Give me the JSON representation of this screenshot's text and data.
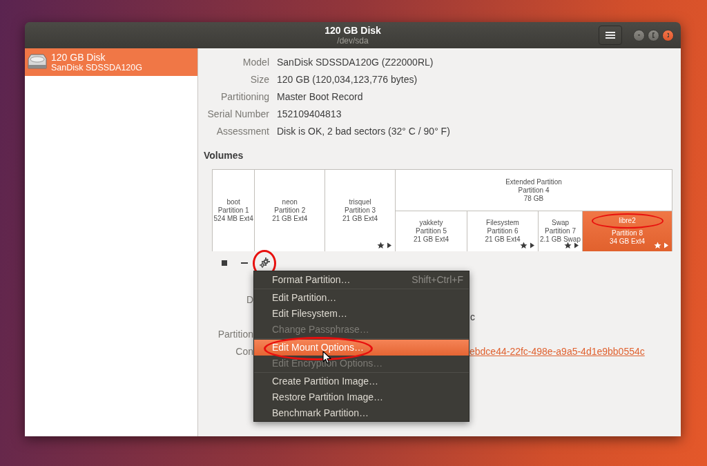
{
  "window": {
    "title": "120 GB Disk",
    "subtitle": "/dev/sda"
  },
  "sidebar": {
    "items": [
      {
        "title": "120 GB Disk",
        "subtitle": "SanDisk SDSSDA120G",
        "selected": true
      }
    ]
  },
  "drive_info": [
    {
      "label": "Model",
      "value": "SanDisk SDSSDA120G (Z22000RL)"
    },
    {
      "label": "Size",
      "value": "120 GB (120,034,123,776 bytes)"
    },
    {
      "label": "Partitioning",
      "value": "Master Boot Record"
    },
    {
      "label": "Serial Number",
      "value": "152109404813"
    },
    {
      "label": "Assessment",
      "value": "Disk is OK, 2 bad sectors (32° C / 90° F)"
    }
  ],
  "volumes": {
    "heading": "Volumes",
    "partitions": [
      {
        "name": "boot",
        "number": "Partition 1",
        "size": "524 MB Ext4",
        "selected": false,
        "show_actions": false,
        "circled": false
      },
      {
        "name": "neon",
        "number": "Partition 2",
        "size": "21 GB Ext4",
        "selected": false,
        "show_actions": false,
        "circled": false
      },
      {
        "name": "trisquel",
        "number": "Partition 3",
        "size": "21 GB Ext4",
        "selected": false,
        "show_actions": true,
        "circled": false
      },
      {
        "name": "Extended Partition",
        "number": "Partition 4",
        "size": "78 GB",
        "selected": false,
        "children": [
          {
            "name": "yakkety",
            "number": "Partition 5",
            "size": "21 GB Ext4",
            "selected": false,
            "show_actions": false,
            "circled": false
          },
          {
            "name": "Filesystem",
            "number": "Partition 6",
            "size": "21 GB Ext4",
            "selected": false,
            "show_actions": true,
            "circled": false
          },
          {
            "name": "Swap",
            "number": "Partition 7",
            "size": "2.1 GB Swap",
            "selected": false,
            "show_actions": true,
            "circled": false
          },
          {
            "name": "libre2",
            "number": "Partition 8",
            "size": "34 GB Ext4",
            "selected": true,
            "show_actions": true,
            "circled": true
          }
        ]
      }
    ],
    "toolbar": [
      {
        "kind": "stop",
        "circled": false
      },
      {
        "kind": "delete",
        "circled": false
      },
      {
        "kind": "settings",
        "circled": true
      }
    ]
  },
  "partition_details": [
    {
      "label": "D"
    },
    {
      "value": "c"
    },
    {
      "label": "Partition"
    },
    {
      "label": "Con",
      "link": "ebdce44-22fc-498e-a9a5-4d1e9bb0554c"
    }
  ],
  "context_menu": {
    "items": [
      {
        "kind": "item",
        "label": "Format Partition…",
        "shortcut": "Shift+Ctrl+F",
        "disabled": false,
        "selected": false,
        "circled": false
      },
      {
        "kind": "separator"
      },
      {
        "kind": "item",
        "label": "Edit Partition…",
        "disabled": false,
        "selected": false,
        "circled": false
      },
      {
        "kind": "item",
        "label": "Edit Filesystem…",
        "disabled": false,
        "selected": false,
        "circled": false
      },
      {
        "kind": "item",
        "label": "Change Passphrase…",
        "disabled": true,
        "selected": false,
        "circled": false
      },
      {
        "kind": "separator"
      },
      {
        "kind": "item",
        "label": "Edit Mount Options…",
        "disabled": false,
        "selected": true,
        "circled": true
      },
      {
        "kind": "item",
        "label": "Edit Encryption Options…",
        "disabled": true,
        "selected": false,
        "circled": false
      },
      {
        "kind": "separator"
      },
      {
        "kind": "item",
        "label": "Create Partition Image…",
        "disabled": false,
        "selected": false,
        "circled": false
      },
      {
        "kind": "item",
        "label": "Restore Partition Image…",
        "disabled": false,
        "selected": false,
        "circled": false
      },
      {
        "kind": "item",
        "label": "Benchmark Partition…",
        "disabled": false,
        "selected": false,
        "circled": false
      }
    ]
  }
}
